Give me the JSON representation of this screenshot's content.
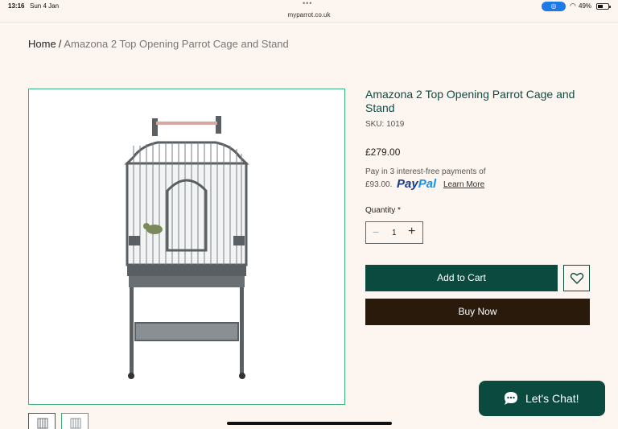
{
  "status_bar": {
    "time": "13:16",
    "date": "Sun 4 Jan",
    "url": "myparrot.co.uk",
    "battery": "49%"
  },
  "breadcrumb": {
    "home": "Home",
    "separator": "/",
    "current": "Amazona 2 Top Opening Parrot Cage and Stand"
  },
  "product": {
    "title": "Amazona 2 Top Opening Parrot Cage and Stand",
    "sku": "SKU: 1019",
    "price": "£279.00",
    "paypal": {
      "line1": "Pay in 3 interest-free payments of",
      "amount": "£93.00.",
      "logo_pay": "Pay",
      "logo_pal": "Pal",
      "learn_more": "Learn More"
    },
    "quantity_label": "Quantity *",
    "quantity": "1",
    "add_to_cart": "Add to Cart",
    "buy_now": "Buy Now"
  },
  "gallery": {
    "main_image": "cage-image",
    "thumbnails": [
      "cage-thumb",
      "cage-thumb"
    ]
  },
  "chat": {
    "label": "Let's Chat!"
  },
  "colors": {
    "background": "#fdf5ef",
    "accent": "#0b4a3f",
    "buy_now": "#2a1a0c",
    "image_border": "#3ab07a",
    "title": "#0d4d45"
  }
}
